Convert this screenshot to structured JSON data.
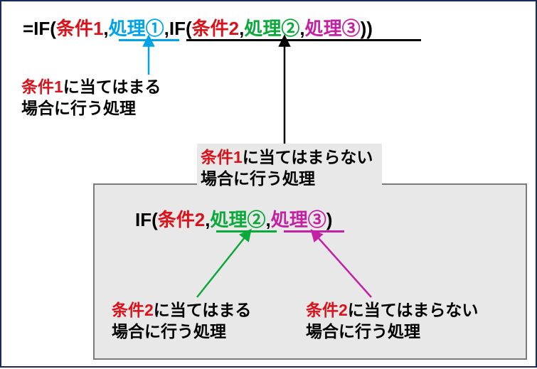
{
  "topFormula": {
    "eq": "=IF(",
    "cond1": "条件1",
    "c1": ",",
    "proc1": "処理①",
    "c2": ",IF(",
    "cond2": "条件2",
    "c3": ",",
    "proc2": "処理②",
    "c4": ",",
    "proc3": "処理③",
    "close": "))"
  },
  "cap1": {
    "a": "条件1",
    "b": "に当てはまる",
    "c": "場合に行う処理"
  },
  "cap2": {
    "a": "条件1",
    "b": "に当てはまらない",
    "c": "場合に行う処理"
  },
  "innerFormula": {
    "if": "IF(",
    "cond2": "条件2",
    "c1": ",",
    "proc2": "処理②",
    "c2": ",",
    "proc3": "処理③",
    "close": ")"
  },
  "cap3": {
    "a": "条件2",
    "b": "に当てはまる",
    "c": "場合に行う処理"
  },
  "cap4": {
    "a": "条件2",
    "b": "に当てはまらない",
    "c": "場合に行う処理"
  }
}
